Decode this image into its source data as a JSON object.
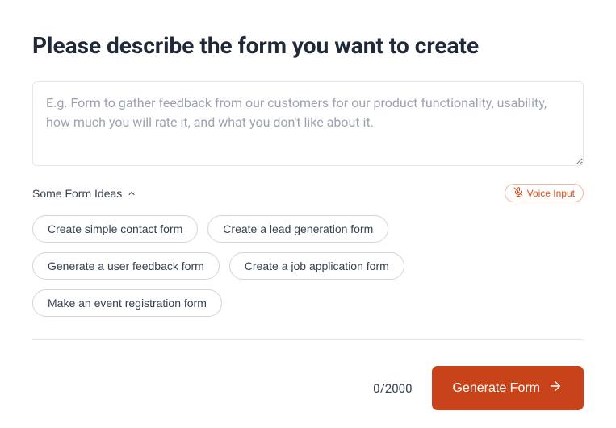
{
  "title": "Please describe the form you want to create",
  "textarea": {
    "placeholder": "E.g. Form to gather feedback from our customers for our product functionality, usability, how much you will rate it, and what you don't like about it.",
    "value": ""
  },
  "ideas": {
    "toggle_label": "Some Form Ideas",
    "items": [
      "Create simple contact form",
      "Create a lead generation form",
      "Generate a user feedback form",
      "Create a job application form",
      "Make an event registration form"
    ]
  },
  "voice_input": {
    "label": "Voice Input"
  },
  "footer": {
    "char_count": "0/2000",
    "generate_label": "Generate Form"
  }
}
